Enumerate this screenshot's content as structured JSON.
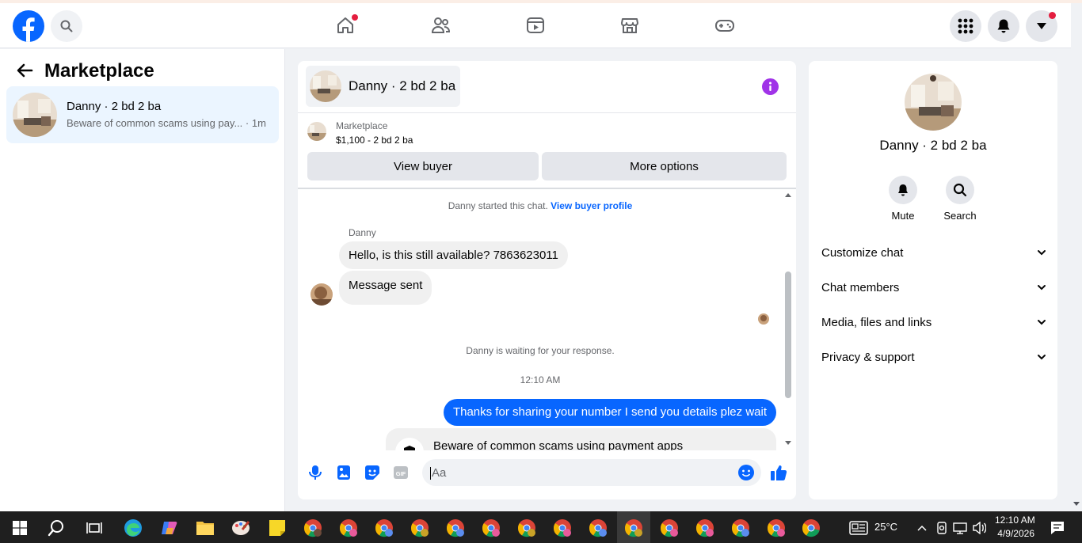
{
  "top_nav": {
    "logo_icon": "facebook-logo-icon",
    "search_icon": "search-icon",
    "center_icons": [
      "home-icon",
      "friends-icon",
      "video-icon",
      "marketplace-icon",
      "gaming-icon"
    ],
    "right_icons": [
      "menu-grid-icon",
      "notifications-bell-icon",
      "account-caret-icon"
    ]
  },
  "sidebar": {
    "title": "Marketplace",
    "conversation": {
      "name": "Danny · 2 bd 2 ba",
      "snippet": "Beware of common scams using pay...",
      "time": " · 1m"
    }
  },
  "chat": {
    "header_name": "Danny · 2 bd 2 ba",
    "listing_source": "Marketplace",
    "listing_title": "$1,100 - 2 bd 2 ba",
    "view_buyer_label": "View buyer",
    "more_options_label": "More options",
    "started_text": "Danny started this chat. ",
    "buyer_profile_link": "View buyer profile",
    "sender_name": "Danny",
    "message_1": "Hello, is this still available? 7863623011",
    "message_2": "Message sent",
    "waiting_text": "Danny is waiting for your response.",
    "timestamp": "12:10 AM",
    "outgoing_message": "Thanks for sharing your number I send you details plez wait",
    "scam_warning_title": "Beware of common scams using payment apps",
    "input_placeholder": "Aa"
  },
  "details_panel": {
    "name": "Danny · 2 bd 2 ba",
    "mute_label": "Mute",
    "search_label": "Search",
    "sections": [
      "Customize chat",
      "Chat members",
      "Media, files and links",
      "Privacy & support"
    ]
  },
  "taskbar": {
    "weather": "25°C",
    "time": "12:10 AM",
    "date": "4/9/2026"
  },
  "colors": {
    "accent": "#0866ff",
    "info_purple": "#a033e8",
    "notification_red": "#e41e3f"
  }
}
